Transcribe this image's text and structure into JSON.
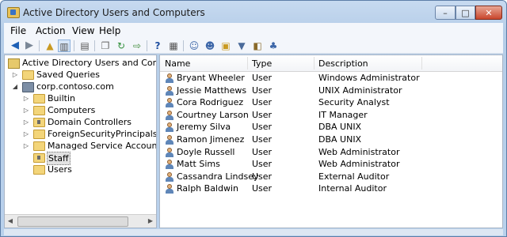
{
  "window": {
    "title": "Active Directory Users and Computers"
  },
  "title_buttons": {
    "minimize": "–",
    "maximize": "□",
    "close": "✕"
  },
  "menu": [
    "File",
    "Action",
    "View",
    "Help"
  ],
  "toolbar_icons": [
    "back-icon",
    "forward-icon",
    "up-folder-icon",
    "show-hide-tree-icon",
    "properties-icon",
    "copy-icon",
    "refresh-icon",
    "export-list-icon",
    "help-icon",
    "mmc-icon",
    "new-user-icon",
    "new-group-icon",
    "new-ou-icon",
    "filter-icon",
    "add-to-group-icon",
    "delegate-icon"
  ],
  "tree": {
    "root": "Active Directory Users and Computers",
    "saved_queries": "Saved Queries",
    "domain": "corp.contoso.com",
    "children": [
      "Builtin",
      "Computers",
      "Domain Controllers",
      "ForeignSecurityPrincipals",
      "Managed Service Accounts",
      "Staff",
      "Users"
    ],
    "selected": "Staff"
  },
  "list": {
    "columns": [
      "Name",
      "Type",
      "Description"
    ],
    "rows": [
      {
        "name": "Bryant Wheeler",
        "type": "User",
        "description": "Windows Administrator"
      },
      {
        "name": "Jessie Matthews",
        "type": "User",
        "description": "UNIX Administrator"
      },
      {
        "name": "Cora Rodriguez",
        "type": "User",
        "description": "Security Analyst"
      },
      {
        "name": "Courtney Larson",
        "type": "User",
        "description": "IT Manager"
      },
      {
        "name": "Jeremy Silva",
        "type": "User",
        "description": "DBA UNIX"
      },
      {
        "name": "Ramon Jimenez",
        "type": "User",
        "description": "DBA UNIX"
      },
      {
        "name": "Doyle Russell",
        "type": "User",
        "description": "Web Administrator"
      },
      {
        "name": "Matt Sims",
        "type": "User",
        "description": "Web Administrator"
      },
      {
        "name": "Cassandra Lindsey",
        "type": "User",
        "description": "External Auditor"
      },
      {
        "name": "Ralph Baldwin",
        "type": "User",
        "description": "Internal Auditor"
      }
    ]
  }
}
